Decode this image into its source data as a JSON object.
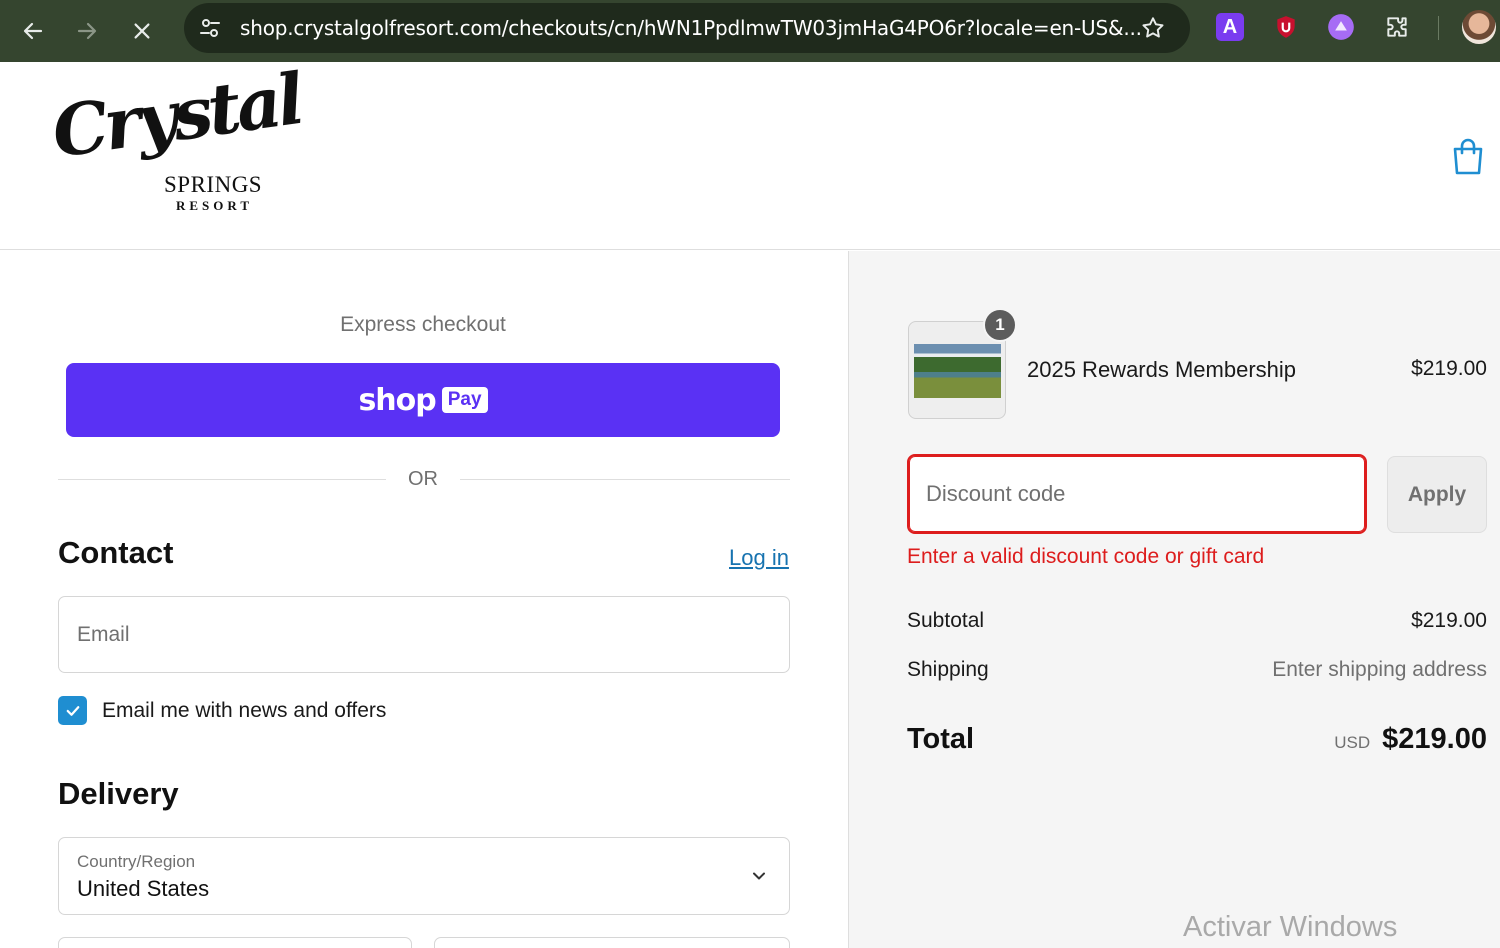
{
  "browser": {
    "url": "shop.crystalgolfresort.com/checkouts/cn/hWN1PpdlmwTW03jmHaG4PO6r?locale=en-US&...",
    "extensions": [
      "a-extension-icon",
      "shield-u-extension-icon",
      "circle-extension-icon",
      "puzzle-icon"
    ]
  },
  "header": {
    "logo": {
      "script": "Crystal",
      "line1": "SPRINGS",
      "line2": "RESORT"
    }
  },
  "express": {
    "title": "Express checkout",
    "shop_pay_word": "shop",
    "shop_pay_badge": "Pay",
    "or": "OR"
  },
  "contact": {
    "heading": "Contact",
    "login": "Log in",
    "email_placeholder": "Email",
    "newsletter_label": "Email me with news and offers",
    "newsletter_checked": true
  },
  "delivery": {
    "heading": "Delivery",
    "country_label": "Country/Region",
    "country_value": "United States"
  },
  "summary": {
    "item": {
      "name": "2025 Rewards Membership",
      "price": "$219.00",
      "quantity": "1"
    },
    "discount_placeholder": "Discount code",
    "apply": "Apply",
    "error": "Enter a valid discount code or gift card",
    "subtotal_label": "Subtotal",
    "subtotal_value": "$219.00",
    "shipping_label": "Shipping",
    "shipping_value": "Enter shipping address",
    "total_label": "Total",
    "total_currency": "USD",
    "total_value": "$219.00"
  },
  "watermark": "Activar Windows",
  "colors": {
    "shop_pay": "#5a31f4",
    "error": "#dd1d1d",
    "link": "#1773b0",
    "checkbox": "#1f8ed1"
  }
}
